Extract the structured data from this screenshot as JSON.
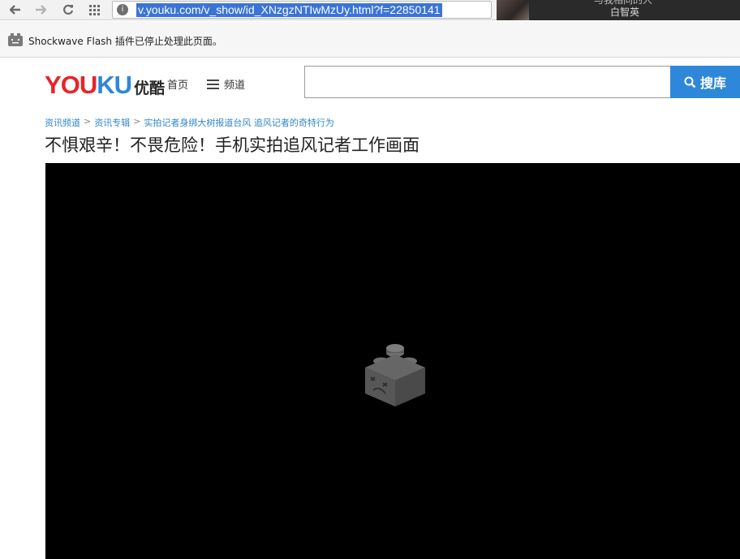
{
  "browser": {
    "url": "v.youku.com/v_show/id_XNzgzNTIwMzUy.html?f=22850141",
    "site_info_glyph": "i",
    "user_name": "白智英",
    "user_top_text": "与我相同的人"
  },
  "infobar": {
    "message": "Shockwave Flash 插件已停止处理此页面。"
  },
  "header": {
    "logo_letters": [
      {
        "char": "Y",
        "color": "#e8232a"
      },
      {
        "char": "O",
        "color": "#e8232a"
      },
      {
        "char": "U",
        "color": "#e8232a"
      },
      {
        "char": "K",
        "color": "#2f87d9"
      },
      {
        "char": "U",
        "color": "#2f87d9"
      }
    ],
    "logo_cn": "优酷",
    "nav_home": "首页",
    "nav_channels": "频道",
    "search_placeholder": "",
    "search_button": "搜库"
  },
  "breadcrumb": {
    "items": [
      "资讯频道",
      "资讯专辑",
      "实拍记者身绑大树报道台风 追风记者的奇特行为"
    ],
    "separator": ">"
  },
  "page_title": "不惧艰辛！不畏危险！手机实拍追风记者工作画面",
  "colors": {
    "accent": "#2f87d9",
    "brand_red": "#e8232a",
    "player_bg": "#000000"
  }
}
